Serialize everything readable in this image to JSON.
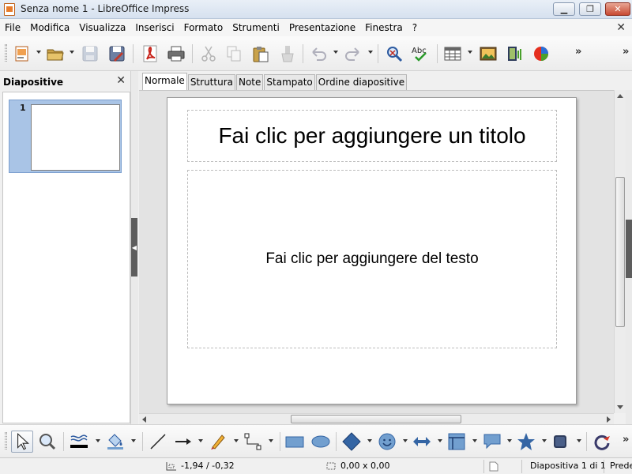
{
  "window": {
    "title": "Senza nome 1 - LibreOffice Impress",
    "minimize_glyph": "▁",
    "maximize_glyph": "❐",
    "close_glyph": "✕"
  },
  "menubar": {
    "items": [
      "File",
      "Modifica",
      "Visualizza",
      "Inserisci",
      "Formato",
      "Strumenti",
      "Presentazione",
      "Finestra",
      "?"
    ],
    "doc_close_glyph": "✕"
  },
  "toolbar": {
    "icons": [
      "new-icon",
      "open-icon",
      "save-icon",
      "edit-file-icon",
      "export-pdf-icon",
      "print-icon",
      "cut-icon",
      "copy-icon",
      "paste-icon",
      "clone-formatting-icon",
      "undo-icon",
      "redo-icon",
      "find-replace-icon",
      "spelling-icon",
      "table-icon",
      "image-icon",
      "movie-icon",
      "chart-icon"
    ],
    "more_glyph": "»"
  },
  "slides_pane": {
    "title": "Diapositive",
    "close_glyph": "✕",
    "slides": [
      {
        "number": "1"
      }
    ]
  },
  "view_tabs": [
    "Normale",
    "Struttura",
    "Note",
    "Stampato",
    "Ordine diapositive"
  ],
  "slide": {
    "title_placeholder": "Fai clic per aggiungere un titolo",
    "body_placeholder": "Fai clic per aggiungere del testo"
  },
  "drawing_toolbar": {
    "icons": [
      "select-icon",
      "zoom-pan-icon",
      "line-color-icon",
      "fill-color-icon",
      "line-icon",
      "arrow-line-icon",
      "freeform-icon",
      "connector-icon",
      "rectangle-icon",
      "ellipse-icon",
      "basic-shapes-icon",
      "symbol-shapes-icon",
      "block-arrows-icon",
      "flowchart-icon",
      "callouts-icon",
      "stars-icon",
      "3d-objects-icon",
      "rotate-icon"
    ]
  },
  "statusbar": {
    "position": "-1,94 / -0,32",
    "size": "0,00 x 0,00",
    "slide_info": "Diapositiva 1 di 1",
    "layout": "Predefinito"
  },
  "colors": {
    "accent": "#a9c4e6",
    "title_bar": "#d6e1ef",
    "close_button": "#c84a33"
  }
}
